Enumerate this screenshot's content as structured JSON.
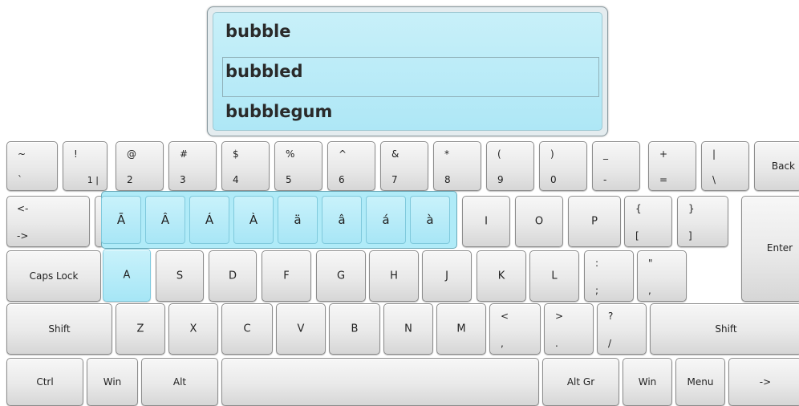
{
  "suggestions": [
    "bubble",
    "bubbled",
    "bubblegum"
  ],
  "row_numbers": [
    {
      "top": "~",
      "bottom": "`"
    },
    {
      "top": "!",
      "bottom": "1"
    },
    {
      "top": "@",
      "bottom": "2"
    },
    {
      "top": "#",
      "bottom": "3"
    },
    {
      "top": "$",
      "bottom": "4"
    },
    {
      "top": "%",
      "bottom": "5"
    },
    {
      "top": "^",
      "bottom": "6"
    },
    {
      "top": "&",
      "bottom": "7"
    },
    {
      "top": "*",
      "bottom": "8"
    },
    {
      "top": "(",
      "bottom": "9"
    },
    {
      "top": ")",
      "bottom": "0"
    },
    {
      "top": "_",
      "bottom": "-"
    },
    {
      "top": "+",
      "bottom": "="
    },
    {
      "top": "|",
      "bottom": "\\"
    }
  ],
  "key_1_extra": "|",
  "back_label": "Back",
  "tab_labels": {
    "top": "<-",
    "bottom": "->"
  },
  "accents": [
    "Ā",
    "Â",
    "Á",
    "À",
    "ä",
    "â",
    "á",
    "à"
  ],
  "row_q_rest": [
    "I",
    "O",
    "P"
  ],
  "brackets": [
    {
      "top": "{",
      "bottom": "["
    },
    {
      "top": "}",
      "bottom": "]"
    }
  ],
  "enter_label": "Enter",
  "caps_label": "Caps Lock",
  "row_a": [
    "A",
    "S",
    "D",
    "F",
    "G",
    "H",
    "J",
    "K",
    "L"
  ],
  "semicolon": {
    "top": ":",
    "bottom": ";"
  },
  "quote": {
    "top": "\"",
    "bottom": ","
  },
  "shift_label": "Shift",
  "row_z": [
    "Z",
    "X",
    "C",
    "V",
    "B",
    "N",
    "M"
  ],
  "comma": {
    "top": "<",
    "bottom": ","
  },
  "period": {
    "top": ">",
    "bottom": "."
  },
  "slash": {
    "top": "?",
    "bottom": "/"
  },
  "bottom_row": {
    "ctrl": "Ctrl",
    "win": "Win",
    "alt": "Alt",
    "altgr": "Alt Gr",
    "win2": "Win",
    "menu": "Menu",
    "arrow": "->"
  }
}
